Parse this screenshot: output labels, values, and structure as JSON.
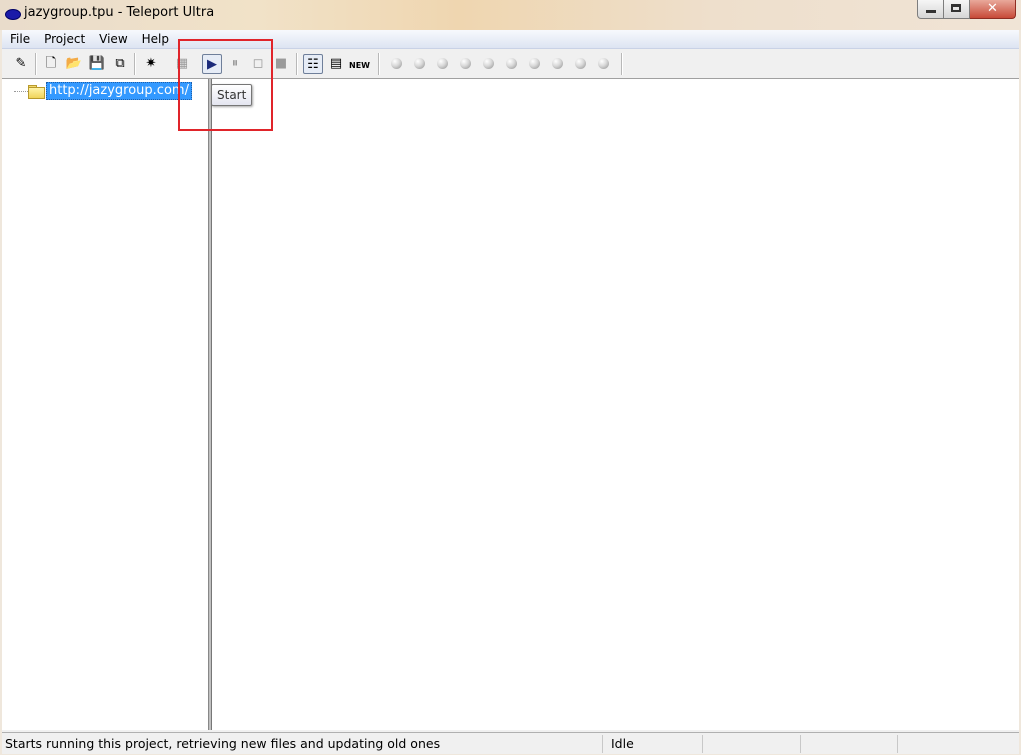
{
  "window": {
    "title": "jazygroup.tpu - Teleport Ultra",
    "close_glyph": "✕"
  },
  "menu": {
    "items": [
      "File",
      "Project",
      "View",
      "Help"
    ]
  },
  "toolbar": {
    "edit_glyph": "✎",
    "new_glyph": "🗋",
    "open_glyph": "📂",
    "save_glyph": "💾",
    "properties_glyph": "⧉",
    "new_address_glyph": "✷",
    "disabled_glyph": "▦",
    "start_glyph": "▶",
    "pause_glyph": "⏸",
    "stop_glyph": "◻",
    "halt_glyph": "■",
    "list_glyph": "☷",
    "grid_glyph": "▤",
    "new_label": "NEW",
    "thread_count": 10
  },
  "tree": {
    "root": "http://jazygroup.com/"
  },
  "tooltip": {
    "text": "Start"
  },
  "status": {
    "message": "Starts running this project, retrieving new files and updating old ones",
    "state": "Idle"
  },
  "colors": {
    "selection": "#3399ff",
    "highlight_box": "#e0242a"
  }
}
